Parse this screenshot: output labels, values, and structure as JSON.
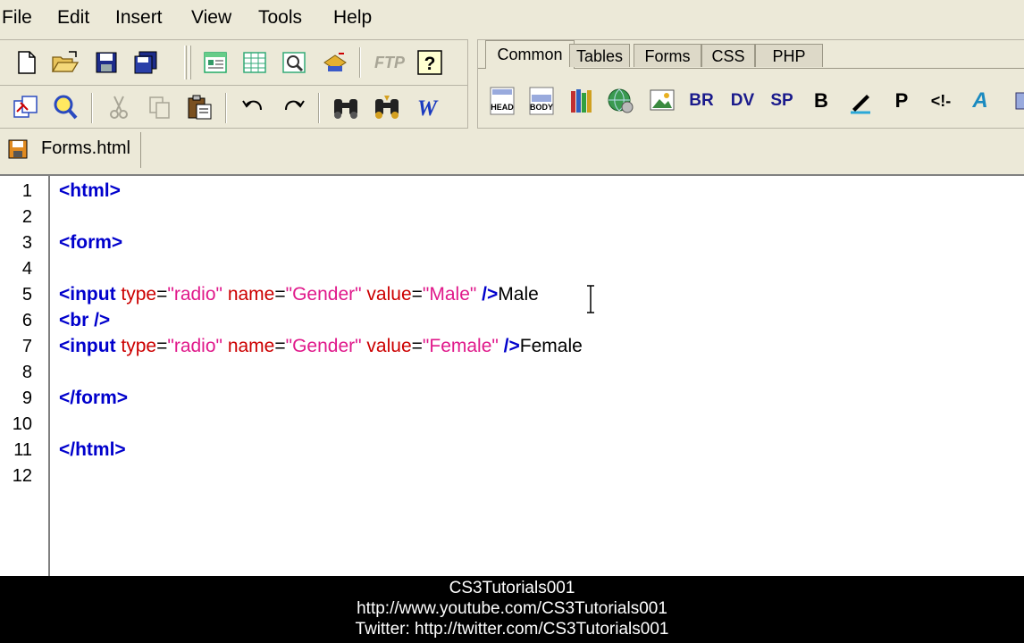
{
  "menu": {
    "items": [
      "File",
      "Edit",
      "Insert",
      "View",
      "Tools",
      "Help"
    ]
  },
  "toolbar_icons": {
    "row1": [
      "new-file-icon",
      "open-folder-icon",
      "save-icon",
      "save-all-icon",
      "page-view-icon",
      "table-icon",
      "preview-icon",
      "properties-icon",
      "ftp-icon",
      "help-icon"
    ],
    "row2": [
      "compare-icon",
      "find-icon",
      "cut-icon",
      "copy-icon",
      "paste-icon",
      "undo-icon",
      "redo-icon",
      "find-binoculars-icon",
      "replace-binoculars-icon",
      "word-icon"
    ]
  },
  "ftp_label": "FTP",
  "insert_bar": {
    "tabs": [
      "Common",
      "Tables",
      "Forms",
      "CSS",
      "PHP"
    ],
    "active_tab": "Common",
    "buttons": {
      "head": "HEAD",
      "body": "BODY",
      "br": "BR",
      "dv": "DV",
      "sp": "SP",
      "b": "B",
      "p": "P",
      "comment": "<!-",
      "a": "A"
    }
  },
  "document": {
    "tab_label": "Forms.html",
    "line_numbers": [
      "1",
      "2",
      "3",
      "4",
      "5",
      "6",
      "7",
      "8",
      "9",
      "10",
      "11",
      "12"
    ],
    "lines": {
      "l1": {
        "tag": "<html>"
      },
      "l3": {
        "tag": "<form>"
      },
      "l5": {
        "open": "<input",
        "a1": " type",
        "eq1": "=",
        "v1": "\"radio\"",
        "a2": " name",
        "eq2": "=",
        "v2": "\"Gender\"",
        "a3": " value",
        "eq3": "=",
        "v3": "\"Male\"",
        "close": " />",
        "text": "Male"
      },
      "l6": {
        "open": "<br",
        "close": " />"
      },
      "l7": {
        "open": "<input",
        "a1": " type",
        "eq1": "=",
        "v1": "\"radio\"",
        "a2": " name",
        "eq2": "=",
        "v2": "\"Gender\"",
        "a3": " value",
        "eq3": "=",
        "v3": "\"Female\"",
        "close": " />",
        "text": "Female"
      },
      "l9": {
        "tag": "</form>"
      },
      "l11": {
        "tag": "</html>"
      }
    }
  },
  "credits": {
    "line1": "CS3Tutorials001",
    "line2": "http://www.youtube.com/CS3Tutorials001",
    "line3": "Twitter: http://twitter.com/CS3Tutorials001"
  },
  "colors": {
    "tag": "#0000cc",
    "attribute": "#cc0000",
    "value": "#e0198b",
    "chrome": "#ece9d8"
  }
}
